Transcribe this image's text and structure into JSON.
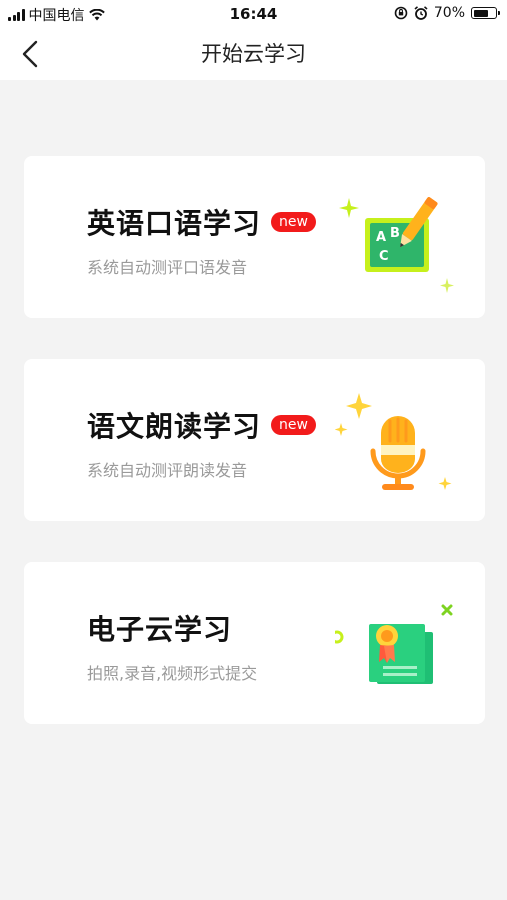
{
  "status": {
    "carrier": "中国电信",
    "time": "16:44",
    "battery": "70%",
    "battery_level": 0.7
  },
  "nav": {
    "title": "开始云学习",
    "back_icon": "chevron-left-icon"
  },
  "cards": [
    {
      "title": "英语口语学习",
      "badge": "new",
      "subtitle": "系统自动测评口语发音",
      "icon": "abc-board-pencil-icon"
    },
    {
      "title": "语文朗读学习",
      "badge": "new",
      "subtitle": "系统自动测评朗读发音",
      "icon": "microphone-icon"
    },
    {
      "title": "电子云学习",
      "subtitle": "拍照,录音,视频形式提交",
      "icon": "certificate-icon"
    }
  ],
  "colors": {
    "badge": "#f21b1b",
    "background": "#f3f3f3",
    "green": "#33c45a",
    "lime": "#c6f01c",
    "orange": "#ff9a1c",
    "yellow": "#ffd43b"
  }
}
